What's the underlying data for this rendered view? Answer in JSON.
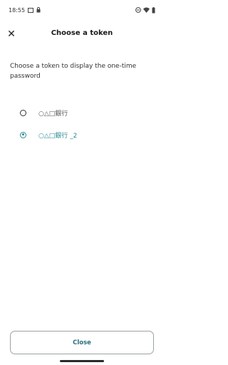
{
  "status_bar": {
    "time": "18:55",
    "left_icons": [
      "screen-icon",
      "lock-icon"
    ],
    "right_icons": [
      "dnd-icon",
      "wifi-icon",
      "battery-icon"
    ]
  },
  "app_bar": {
    "close_icon": "close-icon",
    "title": "Choose a token"
  },
  "prompt": "Choose a token to display the one-time password",
  "tokens": [
    {
      "label": "○△□銀行",
      "selected": false
    },
    {
      "label": "○△□銀行 _2",
      "selected": true
    }
  ],
  "footer": {
    "close_label": "Close"
  },
  "colors": {
    "accent": "#2a8b96",
    "button_text": "#2a6f80"
  }
}
